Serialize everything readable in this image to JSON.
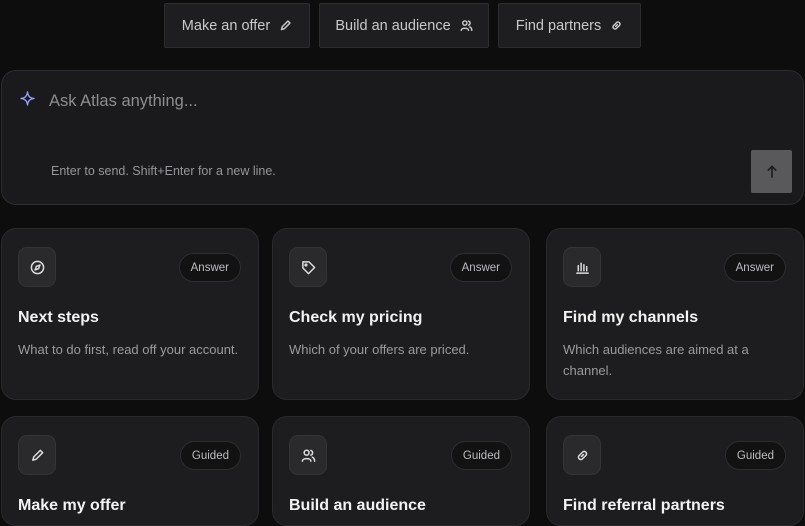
{
  "quick_actions": [
    {
      "label": "Make an offer",
      "icon": "pencil-icon"
    },
    {
      "label": "Build an audience",
      "icon": "users-icon"
    },
    {
      "label": "Find partners",
      "icon": "link-icon"
    }
  ],
  "composer": {
    "placeholder": "Ask Atlas anything...",
    "hint": "Enter to send. Shift+Enter for a new line.",
    "icon": "sparkle-icon",
    "send_icon": "arrow-up-icon",
    "accent_color": "#8fa4ff"
  },
  "cards": [
    {
      "title": "Next steps",
      "badge": "Answer",
      "description": "What to do first, read off your account.",
      "icon": "compass-icon"
    },
    {
      "title": "Check my pricing",
      "badge": "Answer",
      "description": "Which of your offers are priced.",
      "icon": "tag-icon"
    },
    {
      "title": "Find my channels",
      "badge": "Answer",
      "description": "Which audiences are aimed at a channel.",
      "icon": "bar-chart-icon"
    },
    {
      "title": "Make my offer",
      "badge": "Guided",
      "description": "",
      "icon": "pencil-icon"
    },
    {
      "title": "Build an audience",
      "badge": "Guided",
      "description": "",
      "icon": "users-icon"
    },
    {
      "title": "Find referral partners",
      "badge": "Guided",
      "description": "",
      "icon": "link-icon"
    }
  ]
}
